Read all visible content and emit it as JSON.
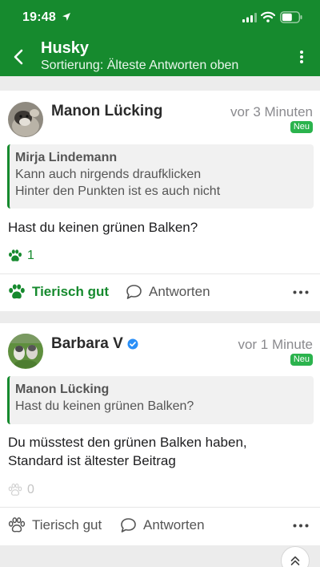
{
  "status_bar": {
    "time": "19:48"
  },
  "header": {
    "title": "Husky",
    "subtitle": "Sortierung: Älteste Antworten oben"
  },
  "colors": {
    "brand_green": "#168a2e",
    "badge_green": "#2bb34d",
    "muted": "#8a8a8e"
  },
  "posts": [
    {
      "author": "Manon Lücking",
      "verified": false,
      "time_ago": "vor 3 Minuten",
      "badge": "Neu",
      "quote": {
        "author": "Mirja Lindemann",
        "lines": [
          "Kann auch nirgends draufklicken",
          "Hinter den Punkten ist es auch nicht"
        ]
      },
      "text_lines": [
        "Hast du keinen grünen Balken?"
      ],
      "likes": "1",
      "like_label": "Tierisch gut",
      "liked": true,
      "reply_label": "Antworten"
    },
    {
      "author": "Barbara V",
      "verified": true,
      "time_ago": "vor 1 Minute",
      "badge": "Neu",
      "quote": {
        "author": "Manon Lücking",
        "lines": [
          "Hast du keinen grünen Balken?"
        ]
      },
      "text_lines": [
        "Du müsstest den grünen Balken haben,",
        "Standard ist ältester Beitrag"
      ],
      "likes": "0",
      "like_label": "Tierisch gut",
      "liked": false,
      "reply_label": "Antworten"
    }
  ]
}
